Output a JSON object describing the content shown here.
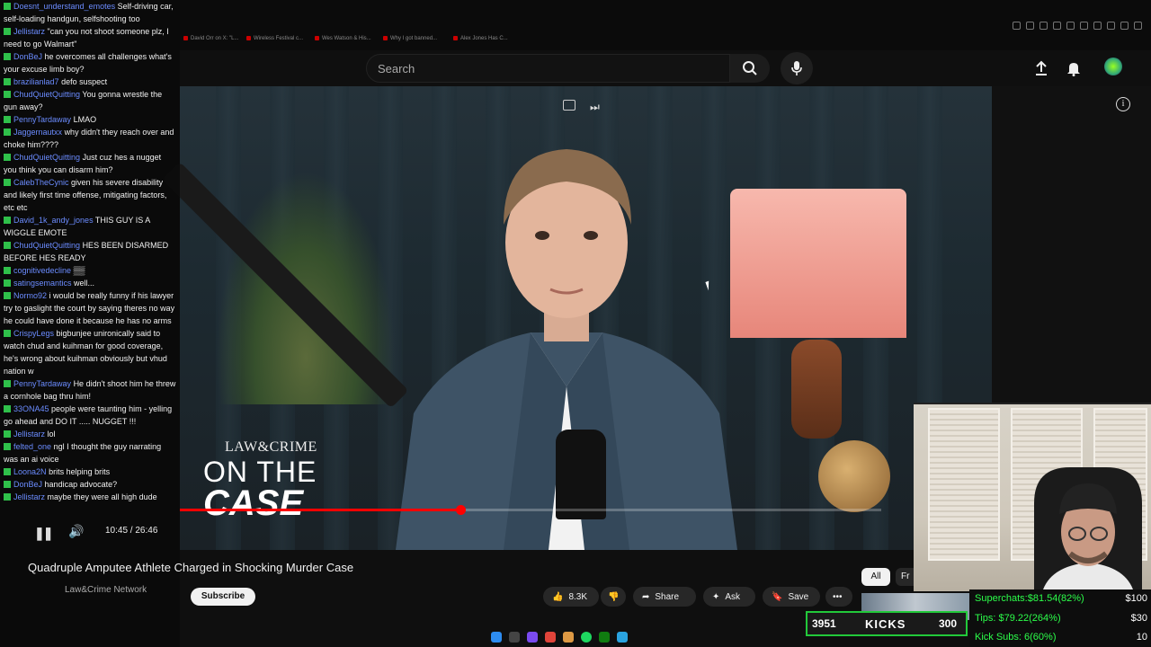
{
  "browser": {
    "bookmarks": [
      "David Orr on X: \"L...",
      "Wireless Festival c...",
      "Wes Watson & His...",
      "Why I got banned...",
      "Alex Jones Has C..."
    ]
  },
  "header": {
    "search_placeholder": "Search",
    "icons": [
      "search-icon",
      "mic-icon",
      "upload-icon",
      "bell-icon",
      "avatar"
    ]
  },
  "video": {
    "logo_line1": "LAW&CRIME",
    "logo_line2": "ON THE",
    "logo_line3": "CASE",
    "progress_fraction": 0.4,
    "timecode": "10:45 / 26:46"
  },
  "below_video": {
    "title": "Quadruple Amputee Athlete Charged in Shocking Murder Case",
    "channel": "Law&Crime Network",
    "subscribe_label": "Subscribe",
    "like_count": "8.3K",
    "share_label": "Share",
    "ask_label": "Ask",
    "save_label": "Save",
    "chip_all": "All",
    "chip_fr": "Fr"
  },
  "chat": {
    "messages": [
      {
        "user": "Doesnt_understand_emotes",
        "text": "Self-driving car, self-loading handgun, selfshooting too"
      },
      {
        "user": "Jellistarz",
        "text": "\"can you not shoot someone plz, I need to go Walmart\""
      },
      {
        "user": "DonBeJ",
        "text": "he overcomes all challenges what's your excuse limb boy?"
      },
      {
        "user": "brazilianlad7",
        "text": "defo suspect"
      },
      {
        "user": "ChudQuietQuitting",
        "text": "You gonna wrestle the gun away?"
      },
      {
        "user": "PennyTardaway",
        "text": "LMAO"
      },
      {
        "user": "Jaggernautxx",
        "text": "why didn't they reach over and choke him????"
      },
      {
        "user": "ChudQuietQuitting",
        "text": "Just cuz hes a nugget you think you can disarm him?"
      },
      {
        "user": "CalebTheCynic",
        "text": "given his severe disability and likely first time offense, mitigating factors, etc etc"
      },
      {
        "user": "David_1k_andy_jones",
        "text": "THIS GUY IS A WIGGLE EMOTE"
      },
      {
        "user": "ChudQuietQuitting",
        "text": "HES BEEN DISARMED BEFORE HES READY"
      },
      {
        "user": "cognitivedecline",
        "text": "▒▒"
      },
      {
        "user": "satingsemantics",
        "text": "well..."
      },
      {
        "user": "Normo92",
        "text": "i would be really funny if his lawyer try to gaslight the court by saying theres no way he could have done it because he has no arms"
      },
      {
        "user": "CrispyLegs",
        "text": "bigbunjee unironically said to watch chud and kuihman for good coverage, he's wrong about kuihman obviously but vhud nation w"
      },
      {
        "user": "PennyTardaway",
        "text": "He didn't shoot him he threw a cornhole bag thru him!"
      },
      {
        "user": "33ONA45",
        "text": "people were taunting him - yelling go ahead and DO IT ..... NUGGET !!!"
      },
      {
        "user": "Jellistarz",
        "text": "lol"
      },
      {
        "user": "felted_one",
        "text": "ngl I thought the guy narrating was an ai voice"
      },
      {
        "user": "Loona2N",
        "text": "brits helping brits"
      },
      {
        "user": "DonBeJ",
        "text": "handicap advocate?"
      },
      {
        "user": "Jellistarz",
        "text": "maybe they were all high dude"
      }
    ]
  },
  "stream_overlay": {
    "kicks_count": "3951",
    "kicks_label": "KICKS",
    "kicks_goal": "300",
    "superchats_label": "Superchats:",
    "superchats_value": "$81.54(82%)",
    "superchats_goal": "$100",
    "tips_label": "Tips:",
    "tips_value": "$79.22(264%)",
    "tips_goal": "$30",
    "kicksubs_label": "Kick Subs:",
    "kicksubs_value": "6(60%)",
    "kicksubs_goal": "10"
  },
  "colors": {
    "accent_red": "#ff0000",
    "chat_green": "#2fc04a",
    "stat_green": "#2cff4a",
    "username_blue": "#6b8cff"
  }
}
